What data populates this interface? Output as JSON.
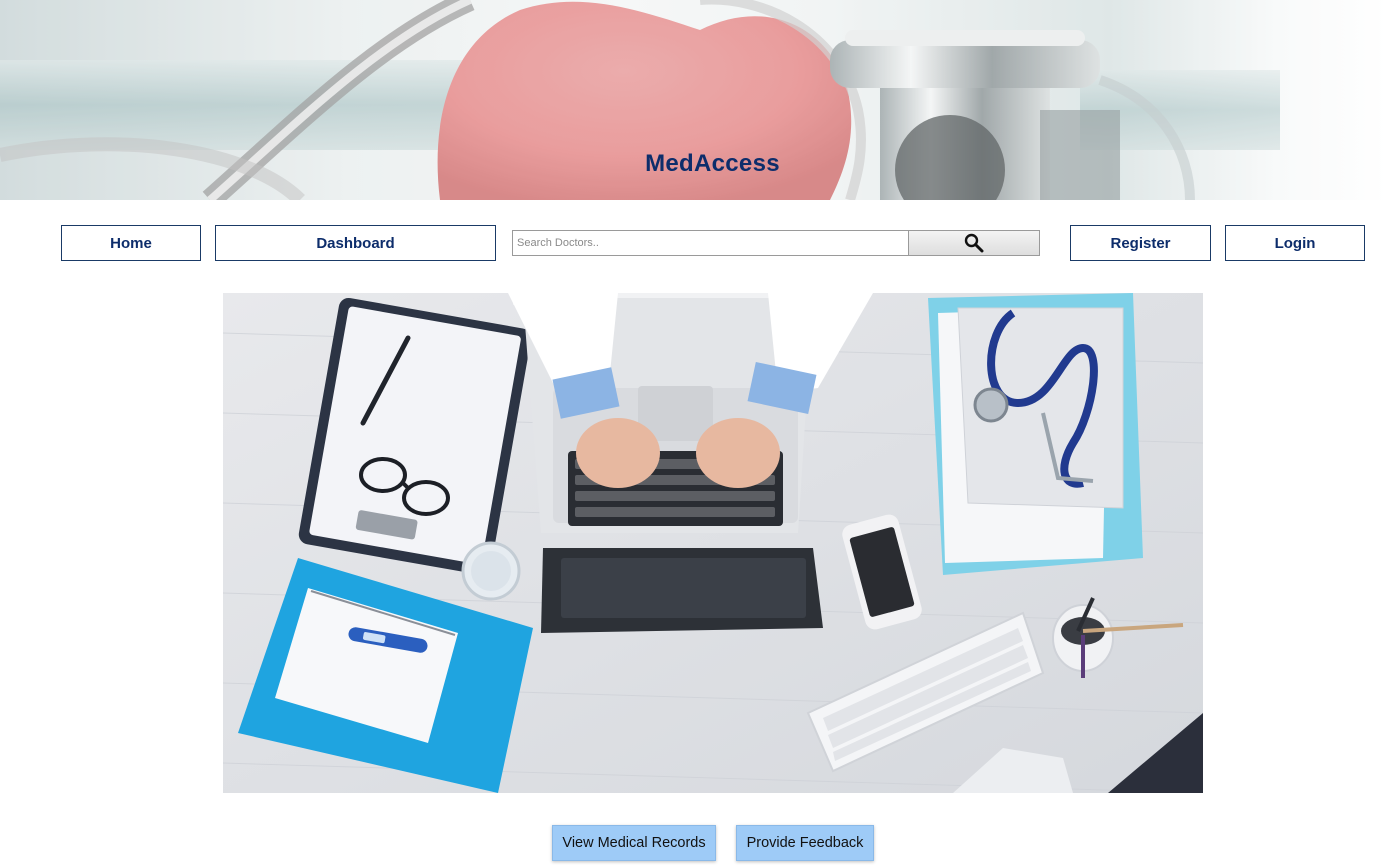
{
  "site": {
    "title": "MedAccess"
  },
  "nav": {
    "home_label": "Home",
    "dashboard_label": "Dashboard",
    "register_label": "Register",
    "login_label": "Login"
  },
  "search": {
    "placeholder": "Search Doctors..",
    "value": "",
    "icon": "search-icon"
  },
  "actions": {
    "view_records_label": "View Medical Records",
    "feedback_label": "Provide Feedback"
  },
  "colors": {
    "brand_text": "#0d2d6b",
    "nav_border": "#1a3a66",
    "action_button_bg": "#9ecbf7"
  }
}
